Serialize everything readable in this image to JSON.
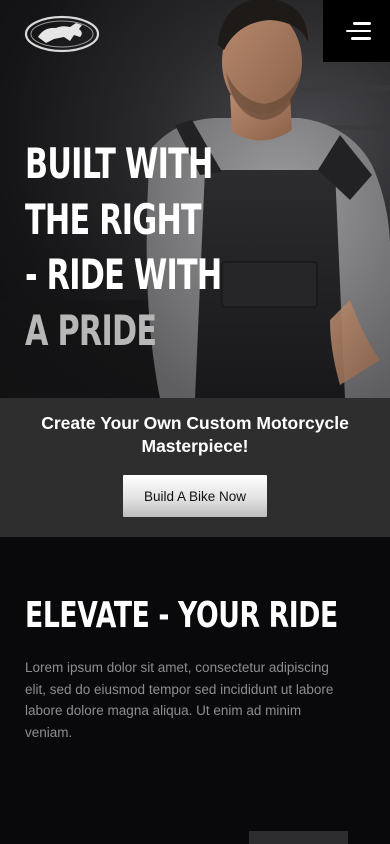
{
  "header": {
    "logo_icon": "horse-emblem-icon",
    "menu_icon": "hamburger-menu-icon"
  },
  "hero": {
    "headline_lines": [
      "BUILT WITH",
      "THE RIGHT",
      "- RIDE WITH",
      "A PRIDE"
    ]
  },
  "cta": {
    "text": "Create Your Own Custom Motorcycle Masterpiece!",
    "button_label": "Build A Bike Now"
  },
  "section": {
    "title": "ELEVATE - YOUR RIDE",
    "body": "Lorem ipsum dolor sit amet, consectetur adipiscing elit, sed do eiusmod tempor sed incididunt ut labore labore dolore magna aliqua. Ut enim ad minim veniam."
  },
  "colors": {
    "background": "#0a0a0c",
    "cta_band": "#2e2e2f",
    "headline_dim": "#b7b7b8",
    "body_text": "#8d8d90"
  }
}
